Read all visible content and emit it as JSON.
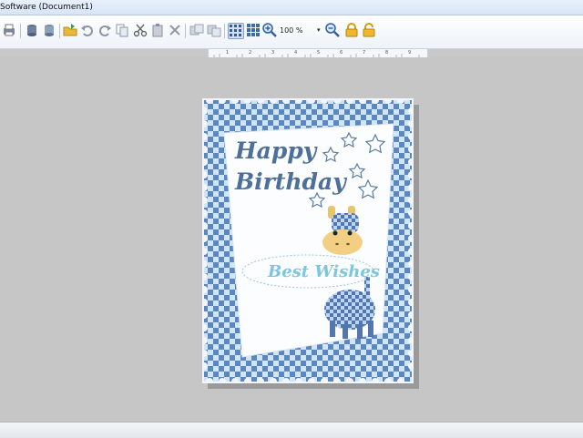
{
  "window": {
    "title": "Software  (Document1)"
  },
  "toolbar": {
    "zoom_value": "100 %",
    "zoom_dropdown": "▾",
    "buttons": [
      "print",
      "database",
      "database-save",
      "open-folder",
      "undo",
      "redo",
      "copy",
      "cut",
      "paste",
      "delete",
      "duplicate",
      "group",
      "grid",
      "zoom-in",
      "zoom-out",
      "lock",
      "unlock"
    ]
  },
  "ruler": {
    "marks": [
      "1",
      "2",
      "3",
      "4",
      "5",
      "6",
      "7",
      "8",
      "9"
    ]
  },
  "card": {
    "line1": "Happy",
    "line2": "Birthday",
    "wish": "Best Wishes",
    "colors": {
      "checker_dark": "#5b86c0",
      "checker_light": "#cfe6fa",
      "title": "#4e6f9a",
      "wish": "#7bc7de"
    }
  }
}
